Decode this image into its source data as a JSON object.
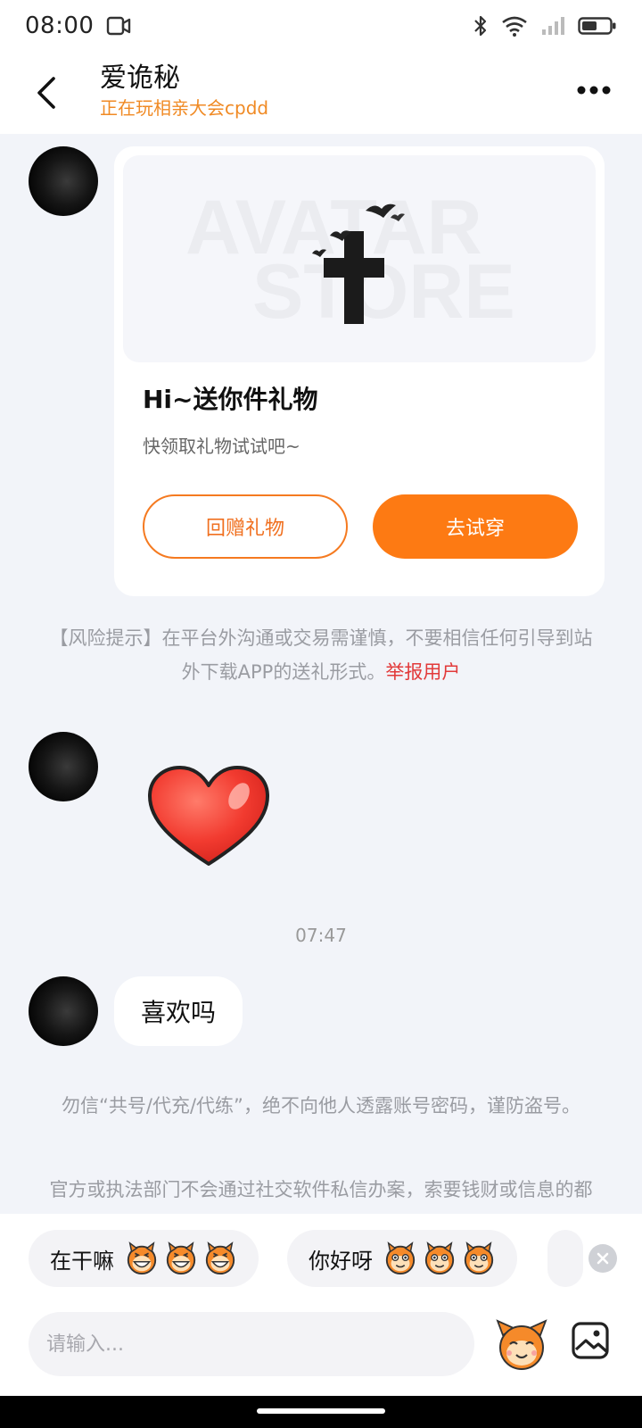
{
  "status_bar": {
    "time": "08:00"
  },
  "header": {
    "title": "爱诡秘",
    "subtitle": "正在玩相亲大会cpdd"
  },
  "gift_card": {
    "watermark_top": "AVATAR",
    "watermark_bottom": "STORE",
    "title": "Hi~送你件礼物",
    "description": "快领取礼物试试吧~",
    "return_gift_label": "回赠礼物",
    "try_on_label": "去试穿"
  },
  "risk_notice": {
    "text": "【风险提示】在平台外沟通或交易需谨慎，不要相信任何引导到站外下载APP的送礼形式。",
    "report_link": "举报用户"
  },
  "timestamp": "07:47",
  "message_text": "喜欢吗",
  "security_notices": [
    "勿信“共号/代充/代练”，绝不向他人透露账号密码，谨防盗号。",
    "官方或执法部门不会通过社交软件私信办案，索要钱财或信息的都属诈骗。"
  ],
  "quick_replies": [
    {
      "text": "在干嘛"
    },
    {
      "text": "你好呀"
    }
  ],
  "input": {
    "placeholder": "请输入..."
  },
  "colors": {
    "accent": "#fd7a13",
    "report": "#e23a3a",
    "subtitle": "#f08a24"
  }
}
